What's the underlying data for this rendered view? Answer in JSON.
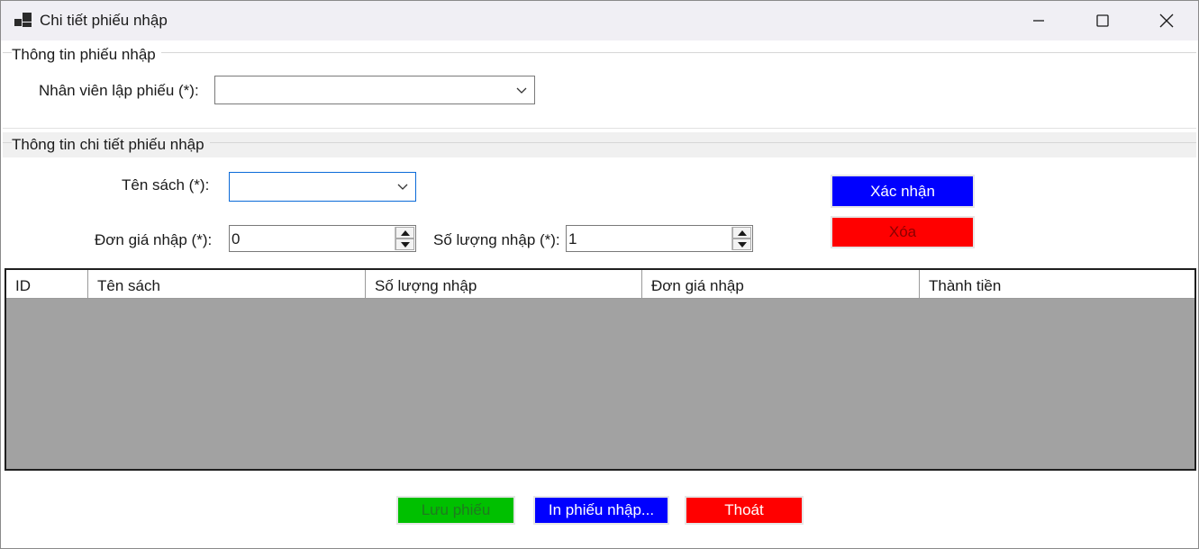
{
  "window": {
    "title": "Chi tiết phiếu nhập",
    "icon": "app-window-icon"
  },
  "group_receipt": {
    "title": "Thông tin phiếu nhập",
    "employee_label": "Nhân viên lập phiếu (*):",
    "employee_value": ""
  },
  "group_details": {
    "title": "Thông tin chi tiết phiếu nhập",
    "book_label": "Tên sách (*):",
    "book_value": "",
    "price_label": "Đơn giá nhập (*):",
    "price_value": "0",
    "quantity_label": "Số lượng nhập (*):",
    "quantity_value": "1",
    "confirm_button": "Xác nhận",
    "delete_button": "Xóa"
  },
  "grid": {
    "columns": [
      "ID",
      "Tên sách",
      "Số lượng nhập",
      "Đơn giá nhập",
      "Thành tiền"
    ],
    "rows": []
  },
  "footer": {
    "save_button": "Lưu phiếu",
    "print_button": "In phiếu nhập...",
    "exit_button": "Thoát"
  },
  "colors": {
    "blue": "#0000ff",
    "red": "#ff0000",
    "green": "#00c000",
    "grid_background": "#a2a2a2"
  }
}
